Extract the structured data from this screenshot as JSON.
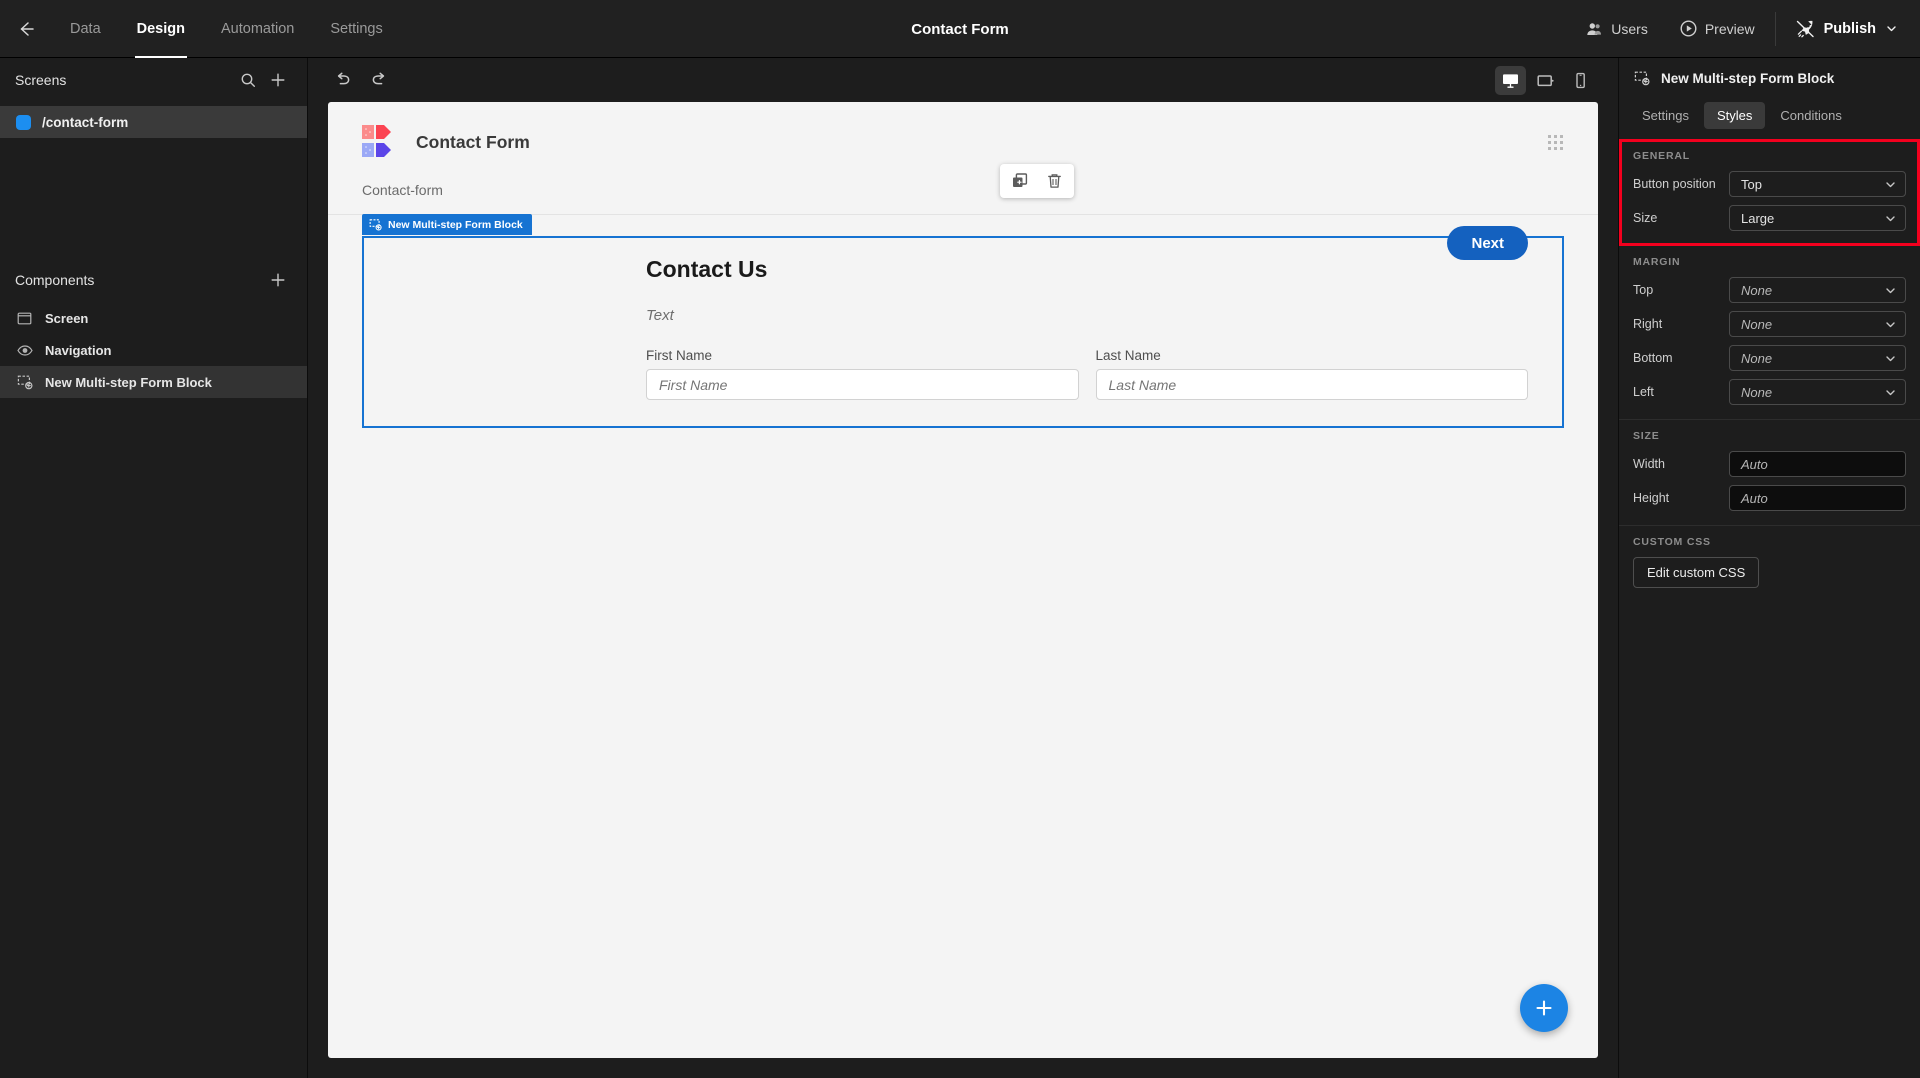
{
  "topbar": {
    "back_icon": "arrow-left-icon",
    "nav": [
      {
        "label": "Data",
        "active": false
      },
      {
        "label": "Design",
        "active": true
      },
      {
        "label": "Automation",
        "active": false
      },
      {
        "label": "Settings",
        "active": false
      }
    ],
    "title": "Contact Form",
    "users_label": "Users",
    "preview_label": "Preview",
    "publish_label": "Publish"
  },
  "sidebar": {
    "screens_title": "Screens",
    "screens": [
      {
        "label": "/contact-form",
        "selected": true
      }
    ],
    "components_title": "Components",
    "components": [
      {
        "label": "Screen",
        "icon": "screen-icon",
        "selected": false
      },
      {
        "label": "Navigation",
        "icon": "eye-icon",
        "selected": false
      },
      {
        "label": "New Multi-step Form Block",
        "icon": "form-block-icon",
        "selected": true
      }
    ]
  },
  "canvas": {
    "undo_icon": "undo-icon",
    "redo_icon": "redo-icon",
    "devices": [
      {
        "name": "desktop",
        "active": true
      },
      {
        "name": "tablet",
        "active": false
      },
      {
        "name": "mobile",
        "active": false
      }
    ],
    "logo_colors": {
      "red_light": "#fb8b8b",
      "red_dark": "#fb4452",
      "purple_light": "#9aa8f6",
      "purple_dark": "#5b45e8"
    },
    "title": "Contact Form",
    "breadcrumb": "Contact-form",
    "float_tools": [
      {
        "name": "duplicate-icon"
      },
      {
        "name": "delete-icon"
      }
    ],
    "block_tag": "New Multi-step Form Block",
    "form": {
      "heading": "Contact Us",
      "text": "Text",
      "next_label": "Next",
      "fields": [
        {
          "label": "First Name",
          "placeholder": "First Name"
        },
        {
          "label": "Last Name",
          "placeholder": "Last Name"
        }
      ]
    },
    "fab_icon": "plus-icon"
  },
  "rightpanel": {
    "header_title": "New Multi-step Form Block",
    "header_icon": "form-block-icon",
    "tabs": [
      {
        "label": "Settings",
        "active": false
      },
      {
        "label": "Styles",
        "active": true
      },
      {
        "label": "Conditions",
        "active": false
      }
    ],
    "highlight_color": "#f3001e",
    "general": {
      "title": "GENERAL",
      "rows": [
        {
          "label": "Button position",
          "value": "Top",
          "placeholder": false
        },
        {
          "label": "Size",
          "value": "Large",
          "placeholder": false
        }
      ]
    },
    "margin": {
      "title": "MARGIN",
      "rows": [
        {
          "label": "Top",
          "value": "None",
          "placeholder": true
        },
        {
          "label": "Right",
          "value": "None",
          "placeholder": true
        },
        {
          "label": "Bottom",
          "value": "None",
          "placeholder": true
        },
        {
          "label": "Left",
          "value": "None",
          "placeholder": true
        }
      ]
    },
    "size": {
      "title": "SIZE",
      "rows": [
        {
          "label": "Width",
          "value": "Auto"
        },
        {
          "label": "Height",
          "value": "Auto"
        }
      ]
    },
    "custom_css": {
      "title": "CUSTOM CSS",
      "button_label": "Edit custom CSS"
    }
  }
}
